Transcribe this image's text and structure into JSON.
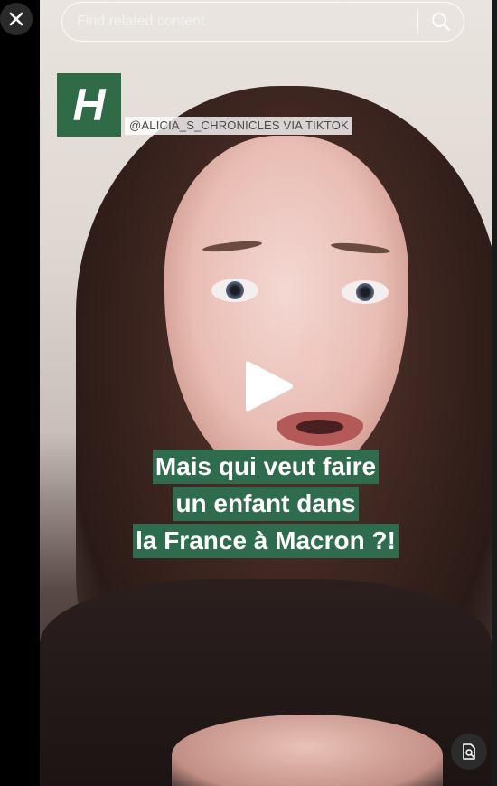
{
  "search": {
    "placeholder": "Find related content"
  },
  "icons": {
    "close": "close-icon",
    "search": "search-icon",
    "play": "play-icon",
    "corner": "scan-search-icon"
  },
  "brand": {
    "logo_letter": "H",
    "logo_color": "#2f6b47",
    "credit": "@ALICIA_S_CHRONICLES VIA TIKTOK"
  },
  "caption": {
    "lines": [
      "Mais qui veut faire",
      "un enfant dans",
      "la France à Macron ?!"
    ],
    "background_color": "#2f6b4d"
  }
}
